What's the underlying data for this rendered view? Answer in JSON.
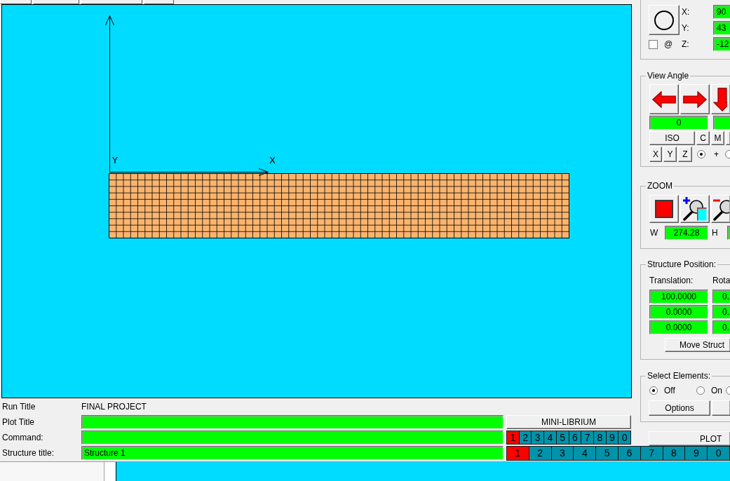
{
  "canvas": {
    "axes": [
      {
        "kind": "y",
        "label": "Y"
      },
      {
        "kind": "x",
        "label": "X"
      }
    ]
  },
  "view_centre": {
    "fields": [
      {
        "label": "X:",
        "value": "90"
      },
      {
        "label": "Y:",
        "value": "43"
      },
      {
        "label": "Z:",
        "value": "-12"
      }
    ],
    "lock": {
      "label": "@",
      "checked": false
    }
  },
  "view_angle": {
    "title": "View Angle",
    "arrows": [
      {
        "kind": "left"
      },
      {
        "kind": "right"
      },
      {
        "kind": "down"
      }
    ],
    "fields": [
      {
        "kind": "value",
        "value": "0"
      },
      {
        "kind": "blank"
      }
    ],
    "buttons": [
      {
        "kind": "label",
        "label": "ISO"
      },
      {
        "kind": "label",
        "label": "C"
      },
      {
        "kind": "label",
        "label": "M"
      },
      {
        "kind": "blank"
      }
    ],
    "axis_buttons": [
      {
        "label": "X"
      },
      {
        "label": "Y"
      },
      {
        "label": "Z"
      }
    ],
    "modes": [
      {
        "label": "+",
        "selected": true
      },
      {
        "selected": false
      }
    ]
  },
  "zoom": {
    "title": "ZOOM",
    "buttons": [
      {
        "kind": "stop"
      },
      {
        "kind": "zoom_in"
      },
      {
        "kind": "zoom_out"
      }
    ],
    "width": {
      "label": "W",
      "value": "274.28"
    },
    "height": {
      "label": "H"
    }
  },
  "structure_position": {
    "title": "Structure Position:",
    "columns": [
      {
        "heading": "Translation:",
        "values": [
          "100.0000",
          "0.0000",
          "0.0000"
        ]
      },
      {
        "heading": "Rota",
        "values": [
          "0.",
          "0.",
          "0."
        ]
      }
    ],
    "button": "Move Struct"
  },
  "select_elements": {
    "title": "Select Elements:",
    "options": [
      {
        "label": "Off",
        "selected": true
      },
      {
        "label": "On",
        "selected": false
      },
      {
        "selected": false
      }
    ],
    "buttons": [
      {
        "kind": "label",
        "label": "Options"
      },
      {
        "kind": "blank"
      }
    ]
  },
  "plot_button": "PLOT",
  "info_rows": [
    {
      "kind": "text",
      "label": "Run Title",
      "value": "FINAL PROJECT"
    },
    {
      "kind": "field",
      "label": "Plot Title"
    },
    {
      "kind": "field",
      "label": "Command:"
    }
  ],
  "mini_librium_button": "MINI-LIBRIUM",
  "small_tabs": [
    {
      "label": "1",
      "selected": true
    },
    {
      "label": "2",
      "selected": false
    },
    {
      "label": "3",
      "selected": false
    },
    {
      "label": "4",
      "selected": false
    },
    {
      "label": "5",
      "selected": false
    },
    {
      "label": "6",
      "selected": false
    },
    {
      "label": "7",
      "selected": false
    },
    {
      "label": "8",
      "selected": false
    },
    {
      "label": "9",
      "selected": false
    },
    {
      "label": "0",
      "selected": false
    }
  ],
  "structure_title": {
    "label": "Structure title:",
    "value": "Structure 1"
  },
  "large_tabs": [
    {
      "label": "1",
      "selected": true
    },
    {
      "label": "2",
      "selected": false
    },
    {
      "label": "3",
      "selected": false
    },
    {
      "label": "4",
      "selected": false
    },
    {
      "label": "5",
      "selected": false
    },
    {
      "label": "6",
      "selected": false
    },
    {
      "label": "7",
      "selected": false
    },
    {
      "label": "8",
      "selected": false
    },
    {
      "label": "9",
      "selected": false
    },
    {
      "label": "0",
      "selected": false
    }
  ]
}
